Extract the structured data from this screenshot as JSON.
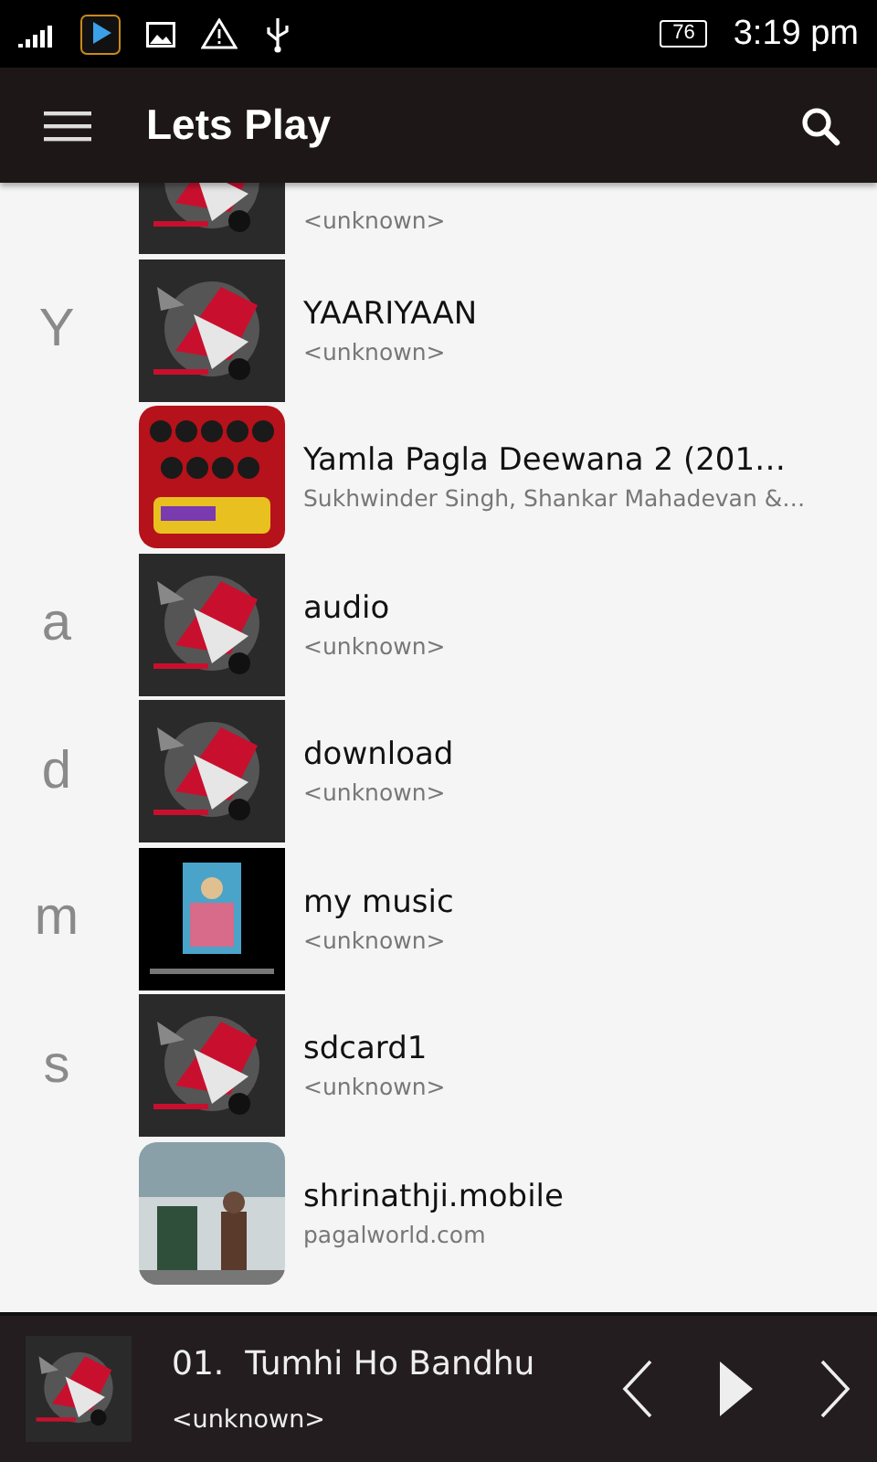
{
  "status_bar": {
    "battery": "76",
    "time": "3:19 pm"
  },
  "toolbar": {
    "title": "Lets Play"
  },
  "songs": [
    {
      "subtitle": "<unknown>"
    },
    {
      "letter": "Y",
      "title": "YAARIYAAN",
      "subtitle": "<unknown>"
    },
    {
      "title": "Yamla Pagla Deewana 2 (201…",
      "subtitle": "Sukhwinder Singh, Shankar Mahadevan &…"
    },
    {
      "letter": "a",
      "title": "audio",
      "subtitle": "<unknown>"
    },
    {
      "letter": "d",
      "title": "download",
      "subtitle": "<unknown>"
    },
    {
      "letter": "m",
      "title": "my music",
      "subtitle": "<unknown>"
    },
    {
      "letter": "s",
      "title": "sdcard1",
      "subtitle": "<unknown>"
    },
    {
      "title": "shrinathji.mobile",
      "subtitle": "pagalworld.com"
    }
  ],
  "player": {
    "title": "01.  Tumhi Ho Bandhu",
    "subtitle": "<unknown>"
  }
}
